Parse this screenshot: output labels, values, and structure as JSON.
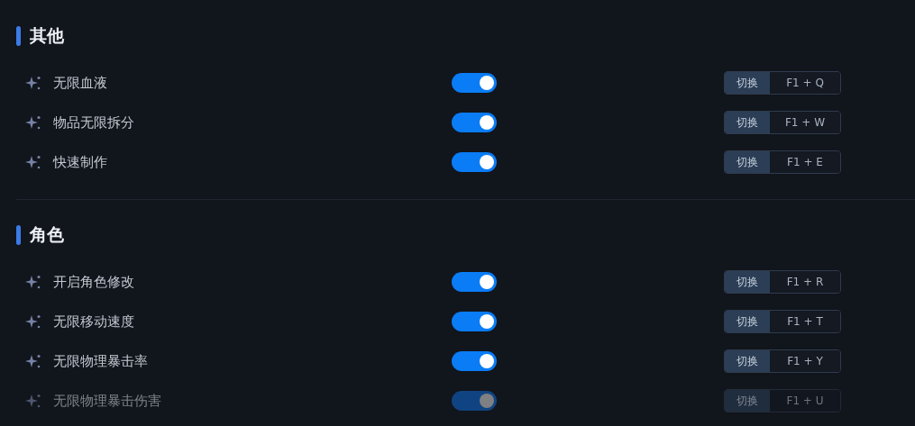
{
  "sections": [
    {
      "title": "其他",
      "items": [
        {
          "label": "无限血液",
          "on": true,
          "disabled": false,
          "hotkey_label": "切换",
          "hotkey": "F1 + Q"
        },
        {
          "label": "物品无限拆分",
          "on": true,
          "disabled": false,
          "hotkey_label": "切换",
          "hotkey": "F1 + W"
        },
        {
          "label": "快速制作",
          "on": true,
          "disabled": false,
          "hotkey_label": "切换",
          "hotkey": "F1 + E"
        }
      ]
    },
    {
      "title": "角色",
      "items": [
        {
          "label": "开启角色修改",
          "on": true,
          "disabled": false,
          "hotkey_label": "切换",
          "hotkey": "F1 + R"
        },
        {
          "label": "无限移动速度",
          "on": true,
          "disabled": false,
          "hotkey_label": "切换",
          "hotkey": "F1 + T"
        },
        {
          "label": "无限物理暴击率",
          "on": true,
          "disabled": false,
          "hotkey_label": "切换",
          "hotkey": "F1 + Y"
        },
        {
          "label": "无限物理暴击伤害",
          "on": true,
          "disabled": true,
          "hotkey_label": "切换",
          "hotkey": "F1 + U"
        }
      ]
    }
  ]
}
